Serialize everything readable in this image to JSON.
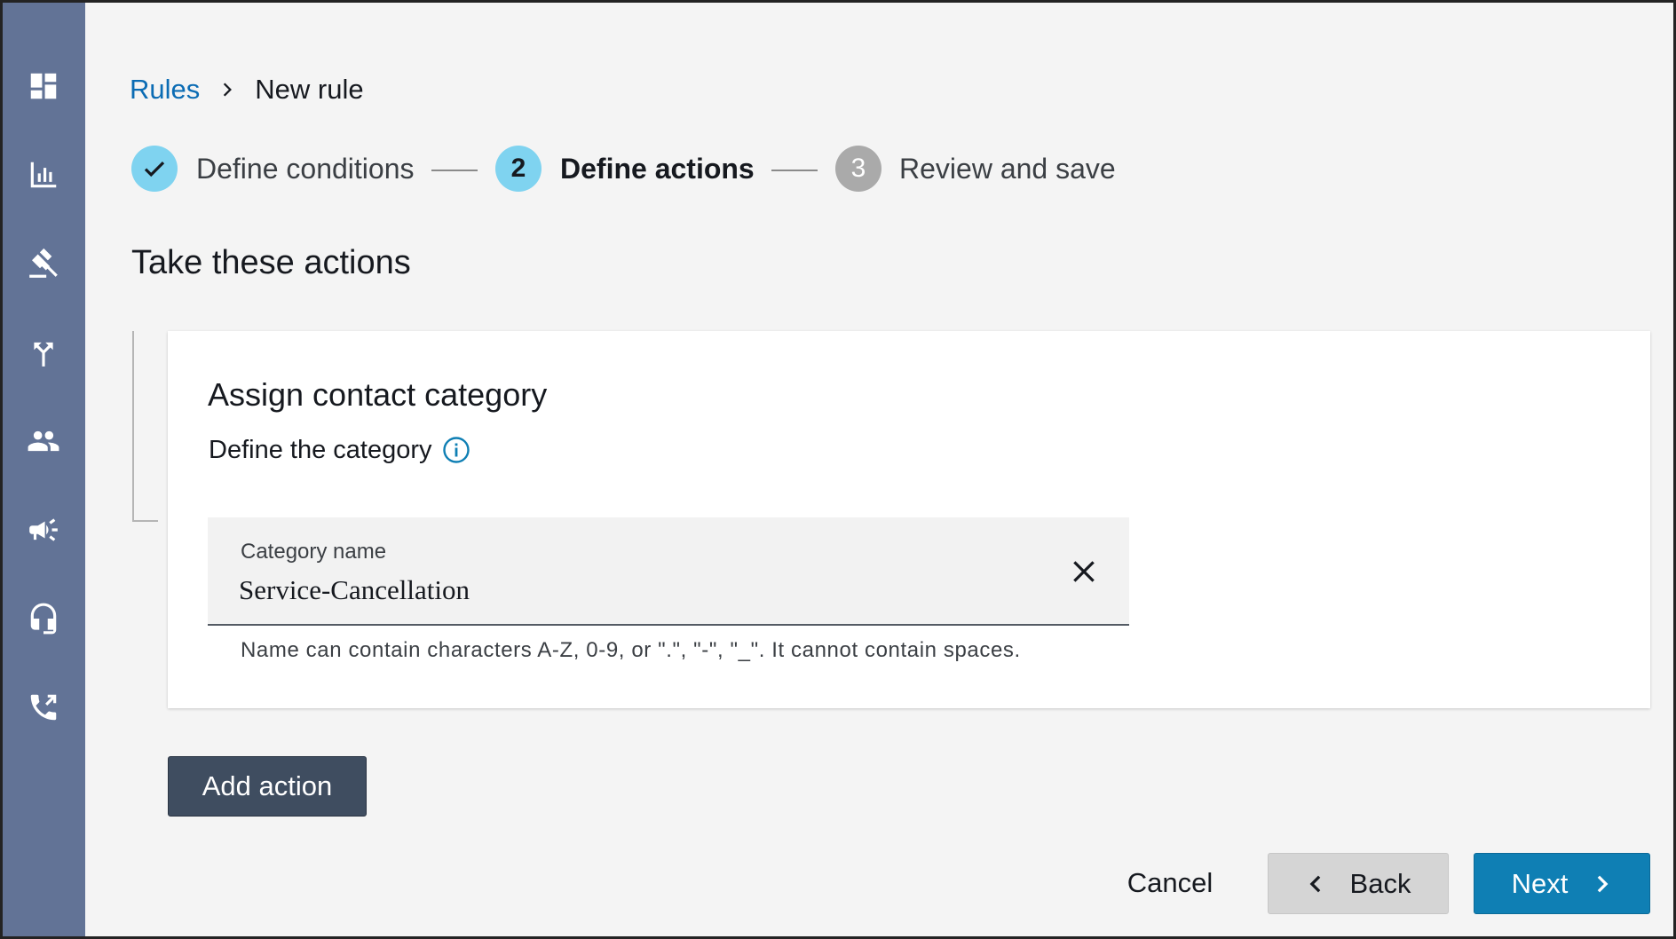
{
  "sidebar": {
    "items": [
      {
        "icon": "dashboard-icon"
      },
      {
        "icon": "bar-chart-icon"
      },
      {
        "icon": "gavel-icon"
      },
      {
        "icon": "routing-icon"
      },
      {
        "icon": "users-icon"
      },
      {
        "icon": "megaphone-icon"
      },
      {
        "icon": "headset-icon"
      },
      {
        "icon": "phone-icon"
      }
    ]
  },
  "breadcrumb": {
    "parent": "Rules",
    "current": "New rule"
  },
  "steps": [
    {
      "number": "1",
      "label": "Define conditions",
      "status": "complete"
    },
    {
      "number": "2",
      "label": "Define actions",
      "status": "current"
    },
    {
      "number": "3",
      "label": "Review and save",
      "status": "upcoming"
    }
  ],
  "section_title": "Take these actions",
  "action_card": {
    "title": "Assign contact category",
    "subtitle": "Define the category",
    "field": {
      "label": "Category name",
      "value": "Service-Cancellation",
      "help": "Name can contain characters A-Z, 0-9, or \".\", \"-\", \"_\". It cannot contain spaces."
    }
  },
  "buttons": {
    "add_action": "Add action",
    "cancel": "Cancel",
    "back": "Back",
    "next": "Next"
  },
  "colors": {
    "sidebar": "#627396",
    "link": "#0b6cb4",
    "step_active": "#7fd3f0",
    "step_upcoming": "#aaaaaa",
    "primary_button": "#0f7fb4",
    "secondary_button": "#3f4d60"
  }
}
